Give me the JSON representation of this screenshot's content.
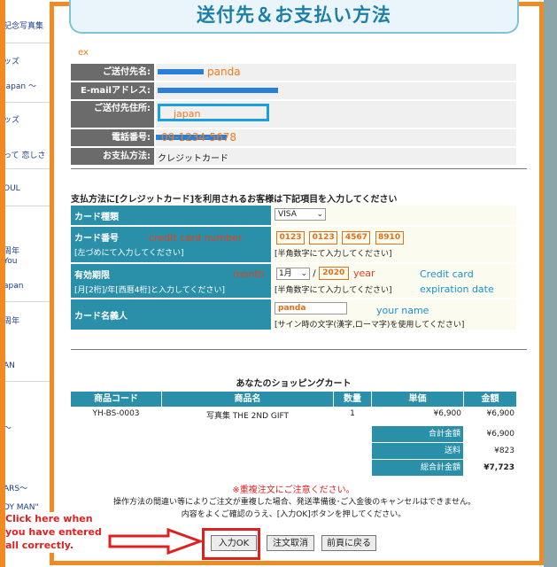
{
  "page_title": "送付先＆お支払い方法",
  "sidebar": {
    "items": [
      {
        "label": "記念写真集"
      },
      {
        "label": "ッズ"
      },
      {
        "label": "Japan ～"
      },
      {
        "label": "ッズ"
      },
      {
        "label": "って 恋しさ"
      },
      {
        "label": "OUL"
      },
      {
        "label": "周年"
      },
      {
        "label": "You"
      },
      {
        "label": "apan"
      },
      {
        "label": "周年"
      },
      {
        "label": "AN"
      },
      {
        "label": "～"
      },
      {
        "label": "ARS～"
      },
      {
        "label": "DY MAN\""
      }
    ]
  },
  "customer": {
    "ex_label": "ex",
    "name_label": "ご送付先名:",
    "name_annotation": "panda",
    "email_label": "E-mailアドレス:",
    "address_label": "ご送付先住所:",
    "address_value": "japan",
    "phone_label": "電話番号:",
    "phone_value": "09-1234-5678",
    "pay_label": "お支払方法:",
    "pay_value": "クレジットカード"
  },
  "payment": {
    "intro": "支払方法に[クレジットカード]を利用されるお客様は下記項目を入力してください",
    "card_type_label": "カード種類",
    "card_type_value": "VISA",
    "card_number_label": "カード番号",
    "card_number_sub": "[左づめにて入力してください]",
    "card_number_annotation": "credit card number",
    "card_number_parts": [
      "0123",
      "0123",
      "4567",
      "8910"
    ],
    "card_number_hint": "[半角数字にて入力してください]",
    "expiry_label": "有効期限",
    "expiry_sub": "[月[2桁]/年[西暦4桁]と入力してください]",
    "expiry_month_annotation": "month",
    "expiry_year_annotation": "year",
    "expiry_month": "1月",
    "expiry_year": "2020",
    "expiry_hint": "[半角数字にて入力してください]",
    "expiry_note_line1": "Credit card",
    "expiry_note_line2": "expiration date",
    "holder_label": "カード名義人",
    "holder_value": "panda",
    "holder_annotation": "your name",
    "holder_hint": "[サイン時の文字(漢字,ローマ字)を使用してください]"
  },
  "cart": {
    "title": "あなたのショッピングカート",
    "headers": [
      "商品コード",
      "商品名",
      "数量",
      "単価",
      "金額"
    ],
    "rows": [
      {
        "code": "YH-BS-0003",
        "name": "写真集 THE 2ND GIFT",
        "qty": "1",
        "unit": "¥6,900",
        "amount": "¥6,900"
      }
    ],
    "subtotal_label": "合計金額",
    "subtotal_value": "¥6,900",
    "shipping_label": "送料",
    "shipping_value": "¥823",
    "total_label": "総合計金額",
    "total_value": "¥7,723"
  },
  "notices": {
    "warning": "※重複注文にご注意ください。",
    "line1": "操作方法の間違い等によりご注文が重複した場合、発送準備後･ご入金後のキャンセルはできません。",
    "line2": "内容をよくご確認のうえ、[入力OK]ボタンを押してください。"
  },
  "buttons": {
    "ok": "入力OK",
    "cancel": "注文取消",
    "back": "前頁に戻る"
  },
  "click_note": {
    "line1": "Click here when",
    "line2": "you have entered",
    "line3": "all correctly."
  },
  "colors": {
    "frame": "#f08a22",
    "table_teal": "#2a8fa8",
    "annotation_red": "#e8401a",
    "annotation_blue": "#1a8fd6"
  }
}
